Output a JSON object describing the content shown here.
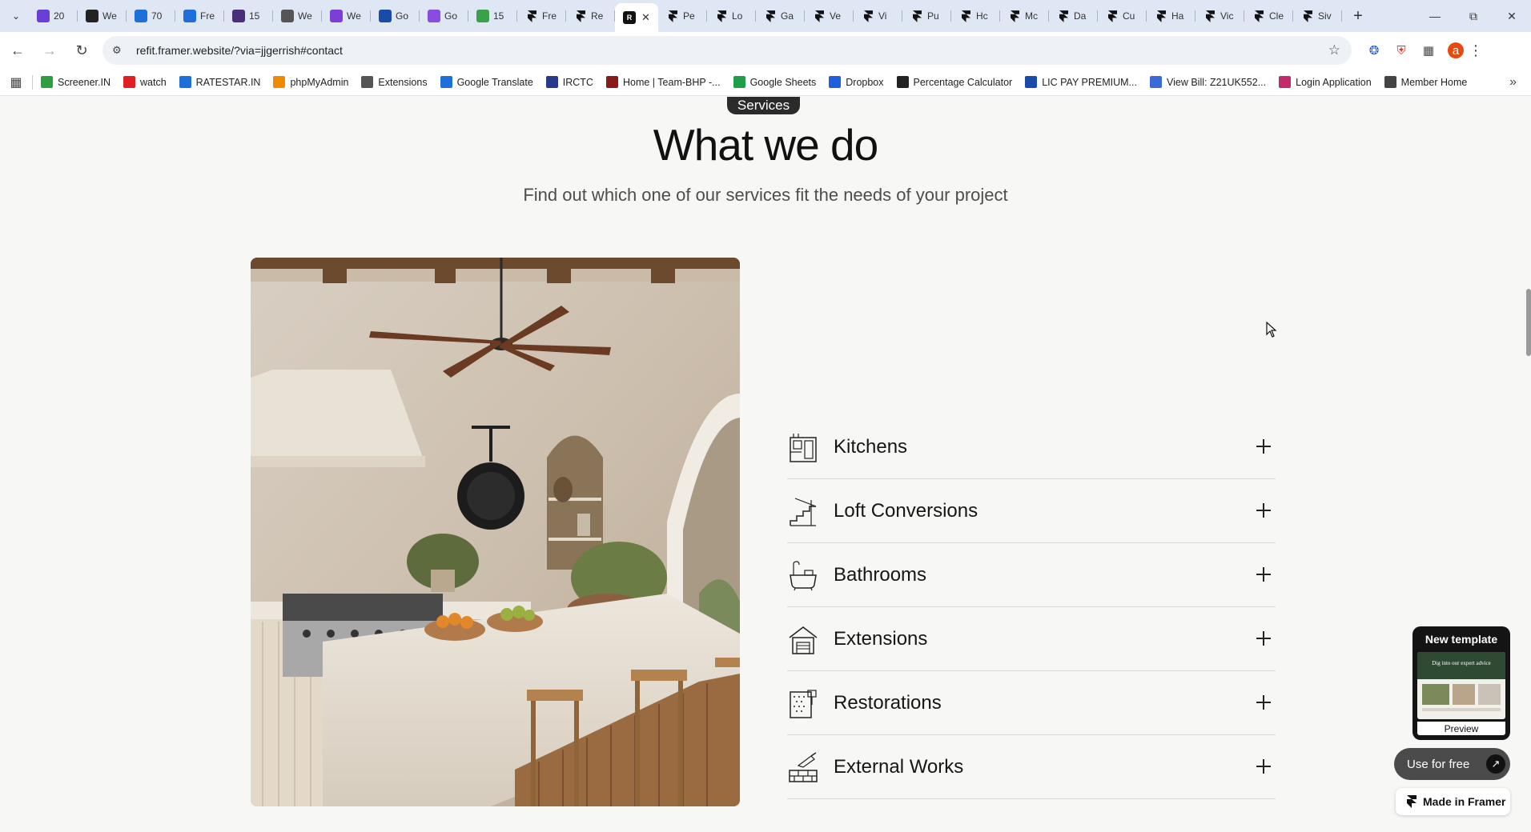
{
  "browser": {
    "tabs": [
      {
        "title": "20",
        "icon": "a-circle-icon",
        "color": "#6a3fd8"
      },
      {
        "title": "We",
        "icon": "wix-icon",
        "color": "#222222"
      },
      {
        "title": "70",
        "icon": "check-icon",
        "color": "#1e6fd9"
      },
      {
        "title": "Fre",
        "icon": "check-icon",
        "color": "#1e6fd9"
      },
      {
        "title": "15",
        "icon": "square-icon",
        "color": "#4a2e7a"
      },
      {
        "title": "We",
        "icon": "feather-icon",
        "color": "#555555"
      },
      {
        "title": "We",
        "icon": "h-icon",
        "color": "#7b3fd8"
      },
      {
        "title": "Go",
        "icon": "form-icon",
        "color": "#1a4ba8"
      },
      {
        "title": "Go",
        "icon": "circle-icon",
        "color": "#8a4be0"
      },
      {
        "title": "15",
        "icon": "leaf-icon",
        "color": "#3aa04a"
      },
      {
        "title": "Fre",
        "icon": "framer-icon",
        "color": "#111111"
      },
      {
        "title": "Re",
        "icon": "framer-icon",
        "color": "#111111"
      },
      {
        "title": "R",
        "icon": "r-icon",
        "color": "#111111",
        "active": true
      },
      {
        "title": "Pe",
        "icon": "framer-icon",
        "color": "#111111"
      },
      {
        "title": "Lo",
        "icon": "framer-icon",
        "color": "#111111"
      },
      {
        "title": "Ga",
        "icon": "framer-icon",
        "color": "#111111"
      },
      {
        "title": "Ve",
        "icon": "framer-icon",
        "color": "#111111"
      },
      {
        "title": "Vi",
        "icon": "framer-icon",
        "color": "#111111"
      },
      {
        "title": "Pu",
        "icon": "framer-icon",
        "color": "#111111"
      },
      {
        "title": "Hc",
        "icon": "framer-icon",
        "color": "#111111"
      },
      {
        "title": "Mc",
        "icon": "framer-icon",
        "color": "#111111"
      },
      {
        "title": "Da",
        "icon": "framer-icon",
        "color": "#111111"
      },
      {
        "title": "Cu",
        "icon": "framer-icon",
        "color": "#111111"
      },
      {
        "title": "Ha",
        "icon": "framer-icon",
        "color": "#111111"
      },
      {
        "title": "Vic",
        "icon": "framer-icon",
        "color": "#111111"
      },
      {
        "title": "Cle",
        "icon": "framer-icon",
        "color": "#111111"
      },
      {
        "title": "Siv",
        "icon": "framer-icon",
        "color": "#111111"
      }
    ],
    "url": "refit.framer.website/?via=jjgerrish#contact",
    "avatar_letter": "a",
    "bookmarks": [
      {
        "label": "Screener.IN",
        "icon": "bar-chart-icon",
        "color": "#2e9e3e"
      },
      {
        "label": "watch",
        "icon": "youtube-icon",
        "color": "#e02020"
      },
      {
        "label": "RATESTAR.IN",
        "icon": "star-icon",
        "color": "#1e6fd9"
      },
      {
        "label": "phpMyAdmin",
        "icon": "php-icon",
        "color": "#f08a00"
      },
      {
        "label": "Extensions",
        "icon": "puzzle-icon",
        "color": "#555555"
      },
      {
        "label": "Google Translate",
        "icon": "translate-icon",
        "color": "#1e6fd9"
      },
      {
        "label": "IRCTC",
        "icon": "irctc-icon",
        "color": "#2a3a8a"
      },
      {
        "label": "Home | Team-BHP -...",
        "icon": "tbhp-icon",
        "color": "#8a1a1a"
      },
      {
        "label": "Google Sheets",
        "icon": "sheets-icon",
        "color": "#1e9e4a"
      },
      {
        "label": "Dropbox",
        "icon": "dropbox-icon",
        "color": "#1e5fe0"
      },
      {
        "label": "Percentage Calculator",
        "icon": "percent-icon",
        "color": "#222222"
      },
      {
        "label": "LIC PAY PREMIUM...",
        "icon": "lic-icon",
        "color": "#1a4ba8"
      },
      {
        "label": "View Bill: Z21UK552...",
        "icon": "bill-icon",
        "color": "#3a6ad8"
      },
      {
        "label": "Login Application",
        "icon": "login-icon",
        "color": "#c22a6a"
      },
      {
        "label": "Member Home",
        "icon": "globe-icon",
        "color": "#444444"
      }
    ]
  },
  "page": {
    "pill_label": "Services",
    "heading": "What we do",
    "subheading": "Find out which one of our services fit the needs of your project",
    "image_alt": "kitchen",
    "services": [
      {
        "label": "Kitchens",
        "icon": "kitchen-icon"
      },
      {
        "label": "Loft Conversions",
        "icon": "loft-stairs-icon"
      },
      {
        "label": "Bathrooms",
        "icon": "bathtub-icon"
      },
      {
        "label": "Extensions",
        "icon": "house-extension-icon"
      },
      {
        "label": "Restorations",
        "icon": "restoration-icon"
      },
      {
        "label": "External Works",
        "icon": "bricks-trowel-icon"
      }
    ]
  },
  "framer": {
    "template_title": "New template",
    "template_thumb_text": "Dig into our expert advice",
    "preview_label": "Preview",
    "use_free_label": "Use for free",
    "made_in_label": "Made in Framer"
  }
}
